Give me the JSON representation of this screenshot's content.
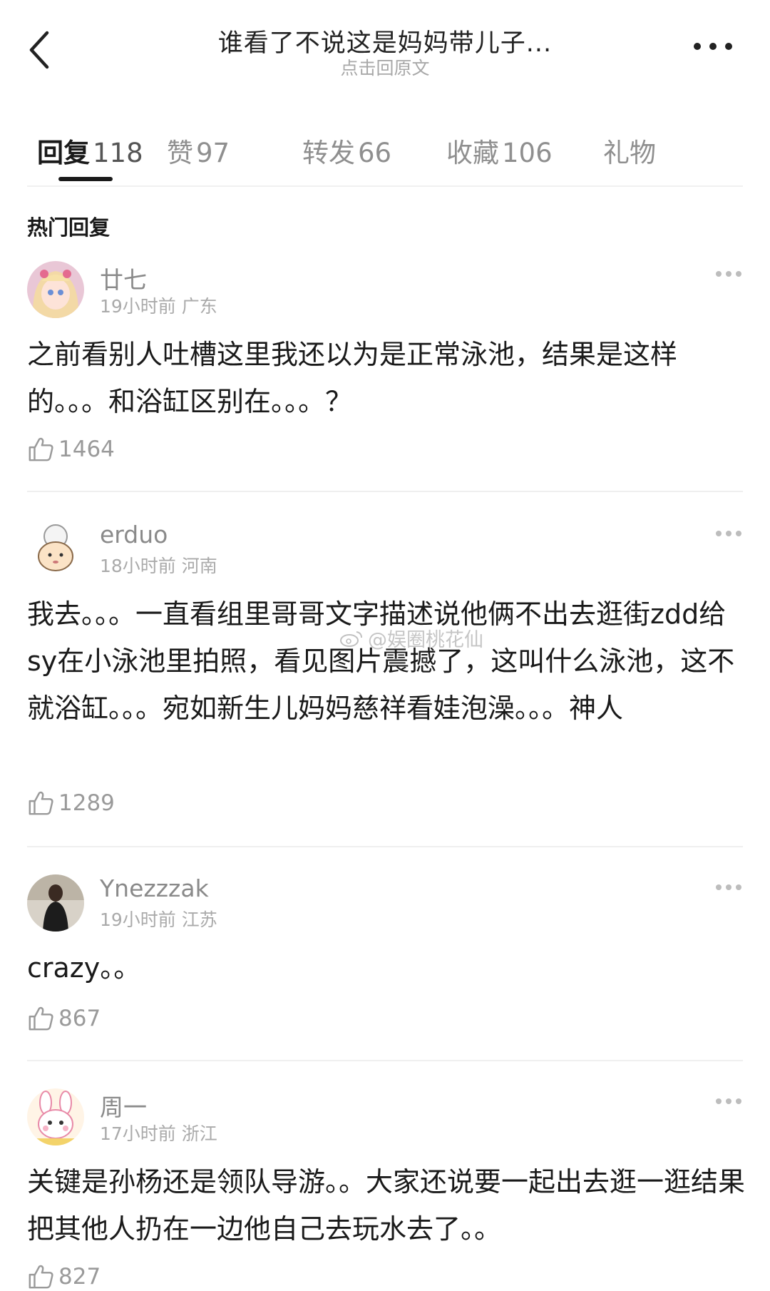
{
  "header": {
    "title": "谁看了不说这是妈妈带儿子...",
    "subtitle": "点击回原文"
  },
  "tabs": [
    {
      "label": "回复",
      "count": "118"
    },
    {
      "label": "赞",
      "count": "97"
    },
    {
      "label": "转发",
      "count": "66"
    },
    {
      "label": "收藏",
      "count": "106"
    },
    {
      "label": "礼物",
      "count": ""
    }
  ],
  "section_title": "热门回复",
  "comments": [
    {
      "username": "廿七",
      "time": "19小时前",
      "location": "广东",
      "text": "之前看别人吐槽这里我还以为是正常泳池，结果是这样的。。。和浴缸区别在。。。？",
      "likes": "1464"
    },
    {
      "username": "erduo",
      "time": "18小时前",
      "location": "河南",
      "text": "我去。。。一直看组里哥哥文字描述说他俩不出去逛街zdd给sy在小泳池里拍照，看见图片震撼了，这叫什么泳池，这不就浴缸。。。宛如新生儿妈妈慈祥看娃泡澡。。。神人",
      "likes": "1289"
    },
    {
      "username": "Ynezzzak",
      "time": "19小时前",
      "location": "江苏",
      "text": "crazy。。",
      "likes": "867"
    },
    {
      "username": "周一",
      "time": "17小时前",
      "location": "浙江",
      "text": "关键是孙杨还是领队导游。。大家还说要一起出去逛一逛结果把其他人扔在一边他自己去玩水去了。。",
      "likes": "827"
    }
  ],
  "watermark": "@娱圈桃花仙",
  "icons": {
    "back": "chevron-left-icon",
    "more": "more-horizontal-icon",
    "like": "thumb-up-icon",
    "watermark": "weibo-logo-icon"
  }
}
